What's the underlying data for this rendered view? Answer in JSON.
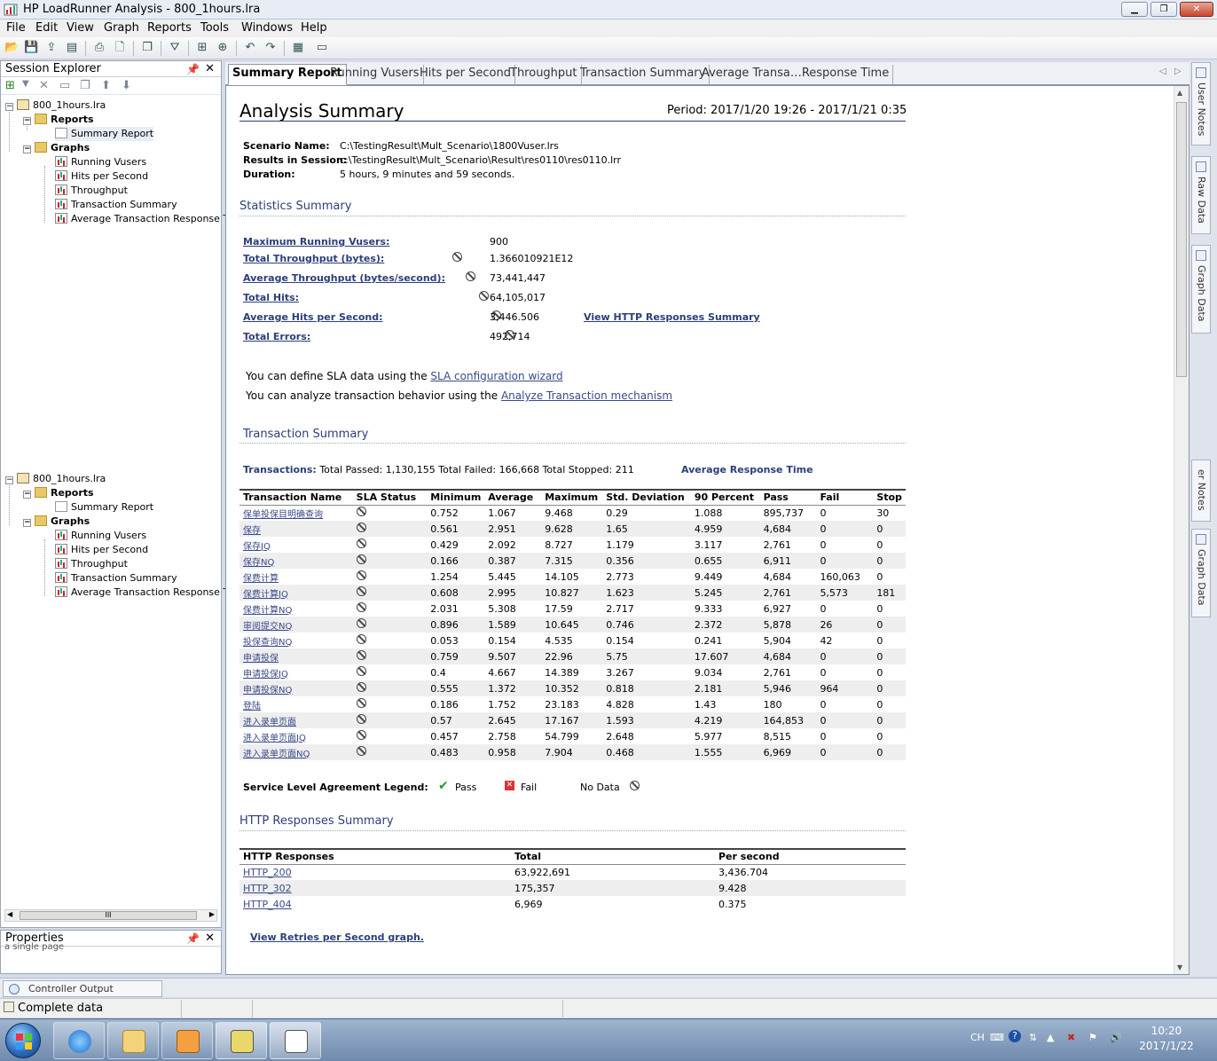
{
  "window": {
    "title": "HP LoadRunner Analysis - 800_1hours.lra",
    "min_label": "▁",
    "restore_label": "❐",
    "close_label": "✕"
  },
  "menu": [
    "File",
    "Edit",
    "View",
    "Graph",
    "Reports",
    "Tools",
    "Windows",
    "Help"
  ],
  "toolbar_icons": [
    "open-icon",
    "save-icon",
    "import-icon",
    "export-icon",
    "print-icon",
    "print-preview-icon",
    "copy-icon",
    "filter-icon",
    "merge-icon",
    "template-icon",
    "undo-icon",
    "redo-icon",
    "report-icon",
    "settings-icon"
  ],
  "session_explorer": {
    "title": "Session Explorer",
    "pin": "📌",
    "close": "✕",
    "tree_top": {
      "root": "800_1hours.lra",
      "reports": "Reports",
      "summary": "Summary Report",
      "graphs": "Graphs",
      "graph_items": [
        "Running Vusers",
        "Hits per Second",
        "Throughput",
        "Transaction Summary",
        "Average Transaction Response Tin"
      ]
    },
    "tree_bottom": {
      "root": "800_1hours.lra",
      "reports": "Reports",
      "summary": "Summary Report",
      "graphs": "Graphs",
      "graph_items": [
        "Running Vusers",
        "Hits per Second",
        "Throughput",
        "Transaction Summary",
        "Average Transaction Response Tin"
      ]
    },
    "scroll_grip": "III"
  },
  "properties": {
    "title": "Properties",
    "note": "a single page"
  },
  "tabs": {
    "items": [
      "Summary Report",
      "Running Vusers",
      "Hits per Second",
      "Throughput",
      "Transaction Summary",
      "Average Transa…Response Time"
    ],
    "active": "Summary Report",
    "prev": "◁",
    "next": "▷"
  },
  "report": {
    "title": "Analysis Summary",
    "period": "Period: 2017/1/20 19:26 - 2017/1/21 0:35",
    "scenario_label": "Scenario Name:",
    "scenario_value": "C:\\TestingResult\\Mult_Scenario\\1800Vuser.lrs",
    "results_label": "Results in Session:",
    "results_value": "c:\\TestingResult\\Mult_Scenario\\Result\\res0110\\res0110.lrr",
    "duration_label": "Duration:",
    "duration_value": "5 hours, 9 minutes and 59 seconds.",
    "stats_title": "Statistics Summary",
    "stats": [
      {
        "label": "Maximum Running Vusers:",
        "value": "900",
        "sla": false
      },
      {
        "label": "Total Throughput (bytes):",
        "value": "1.366010921E12",
        "sla": true
      },
      {
        "label": "Average Throughput (bytes/second):",
        "value": "73,441,447",
        "sla": true
      },
      {
        "label": "Total Hits:",
        "value": "64,105,017",
        "sla": true
      },
      {
        "label": "Average Hits per Second:",
        "value": "3,446.506",
        "sla": true
      },
      {
        "label": "Total Errors:",
        "value": "492,714",
        "sla": true
      }
    ],
    "http_link": "View HTTP Responses Summary",
    "sla_text_1": "You can define SLA data using the ",
    "sla_link_1": "SLA configuration wizard",
    "sla_text_2": "You can analyze transaction behavior using the ",
    "sla_link_2": "Analyze Transaction mechanism",
    "tx_title": "Transaction Summary",
    "tx_totals_label": "Transactions:",
    "tx_totals": "Total Passed: 1,130,155 Total Failed: 166,668 Total Stopped: 211",
    "avg_resp_link": "Average Response Time",
    "tx_columns": [
      "Transaction Name",
      "SLA Status",
      "Minimum",
      "Average",
      "Maximum",
      "Std. Deviation",
      "90 Percent",
      "Pass",
      "Fail",
      "Stop"
    ],
    "tx_rows": [
      [
        "保单投保目明确查询",
        "0.752",
        "1.067",
        "9.468",
        "0.29",
        "1.088",
        "895,737",
        "0",
        "30"
      ],
      [
        "保存",
        "0.561",
        "2.951",
        "9.628",
        "1.65",
        "4.959",
        "4,684",
        "0",
        "0"
      ],
      [
        "保存JQ",
        "0.429",
        "2.092",
        "8.727",
        "1.179",
        "3.117",
        "2,761",
        "0",
        "0"
      ],
      [
        "保存NQ",
        "0.166",
        "0.387",
        "7.315",
        "0.356",
        "0.655",
        "6,911",
        "0",
        "0"
      ],
      [
        "保费计算",
        "1.254",
        "5.445",
        "14.105",
        "2.773",
        "9.449",
        "4,684",
        "160,063",
        "0"
      ],
      [
        "保费计算JQ",
        "0.608",
        "2.995",
        "10.827",
        "1.623",
        "5.245",
        "2,761",
        "5,573",
        "181"
      ],
      [
        "保费计算NQ",
        "2.031",
        "5.308",
        "17.59",
        "2.717",
        "9.333",
        "6,927",
        "0",
        "0"
      ],
      [
        "审阅提交NQ",
        "0.896",
        "1.589",
        "10.645",
        "0.746",
        "2.372",
        "5,878",
        "26",
        "0"
      ],
      [
        "投保查询NQ",
        "0.053",
        "0.154",
        "4.535",
        "0.154",
        "0.241",
        "5,904",
        "42",
        "0"
      ],
      [
        "申请投保",
        "0.759",
        "9.507",
        "22.96",
        "5.75",
        "17.607",
        "4,684",
        "0",
        "0"
      ],
      [
        "申请投保JQ",
        "0.4",
        "4.667",
        "14.389",
        "3.267",
        "9.034",
        "2,761",
        "0",
        "0"
      ],
      [
        "申请投保NQ",
        "0.555",
        "1.372",
        "10.352",
        "0.818",
        "2.181",
        "5,946",
        "964",
        "0"
      ],
      [
        "登陆",
        "0.186",
        "1.752",
        "23.183",
        "4.828",
        "1.43",
        "180",
        "0",
        "0"
      ],
      [
        "进入录单页面",
        "0.57",
        "2.645",
        "17.167",
        "1.593",
        "4.219",
        "164,853",
        "0",
        "0"
      ],
      [
        "进入录单页面JQ",
        "0.457",
        "2.758",
        "54.799",
        "2.648",
        "5.977",
        "8,515",
        "0",
        "0"
      ],
      [
        "进入录单页面NQ",
        "0.483",
        "0.958",
        "7.904",
        "0.468",
        "1.555",
        "6,969",
        "0",
        "0"
      ]
    ],
    "legend_label": "Service Level Agreement Legend:",
    "legend_pass": "Pass",
    "legend_fail": "Fail",
    "legend_nodata": "No Data",
    "http_title": "HTTP Responses Summary",
    "http_columns": [
      "HTTP Responses",
      "Total",
      "Per second"
    ],
    "http_rows": [
      [
        "HTTP_200",
        "63,922,691",
        "3,436.704"
      ],
      [
        "HTTP_302",
        "175,357",
        "9.428"
      ],
      [
        "HTTP_404",
        "6,969",
        "0.375"
      ]
    ],
    "retries_link": "View Retries per Second graph."
  },
  "right_dock": [
    "User Notes",
    "Raw Data",
    "Graph Data",
    "er Notes",
    "Graph Data"
  ],
  "output_tab": "Controller Output Messages",
  "status": "Complete data",
  "tray": {
    "lang": "CH",
    "time": "10:20",
    "date": "2017/1/22"
  },
  "colors": {
    "accent": "#2b3f7a",
    "link": "#3a4a8a",
    "taskbar": "#6f8aad"
  }
}
